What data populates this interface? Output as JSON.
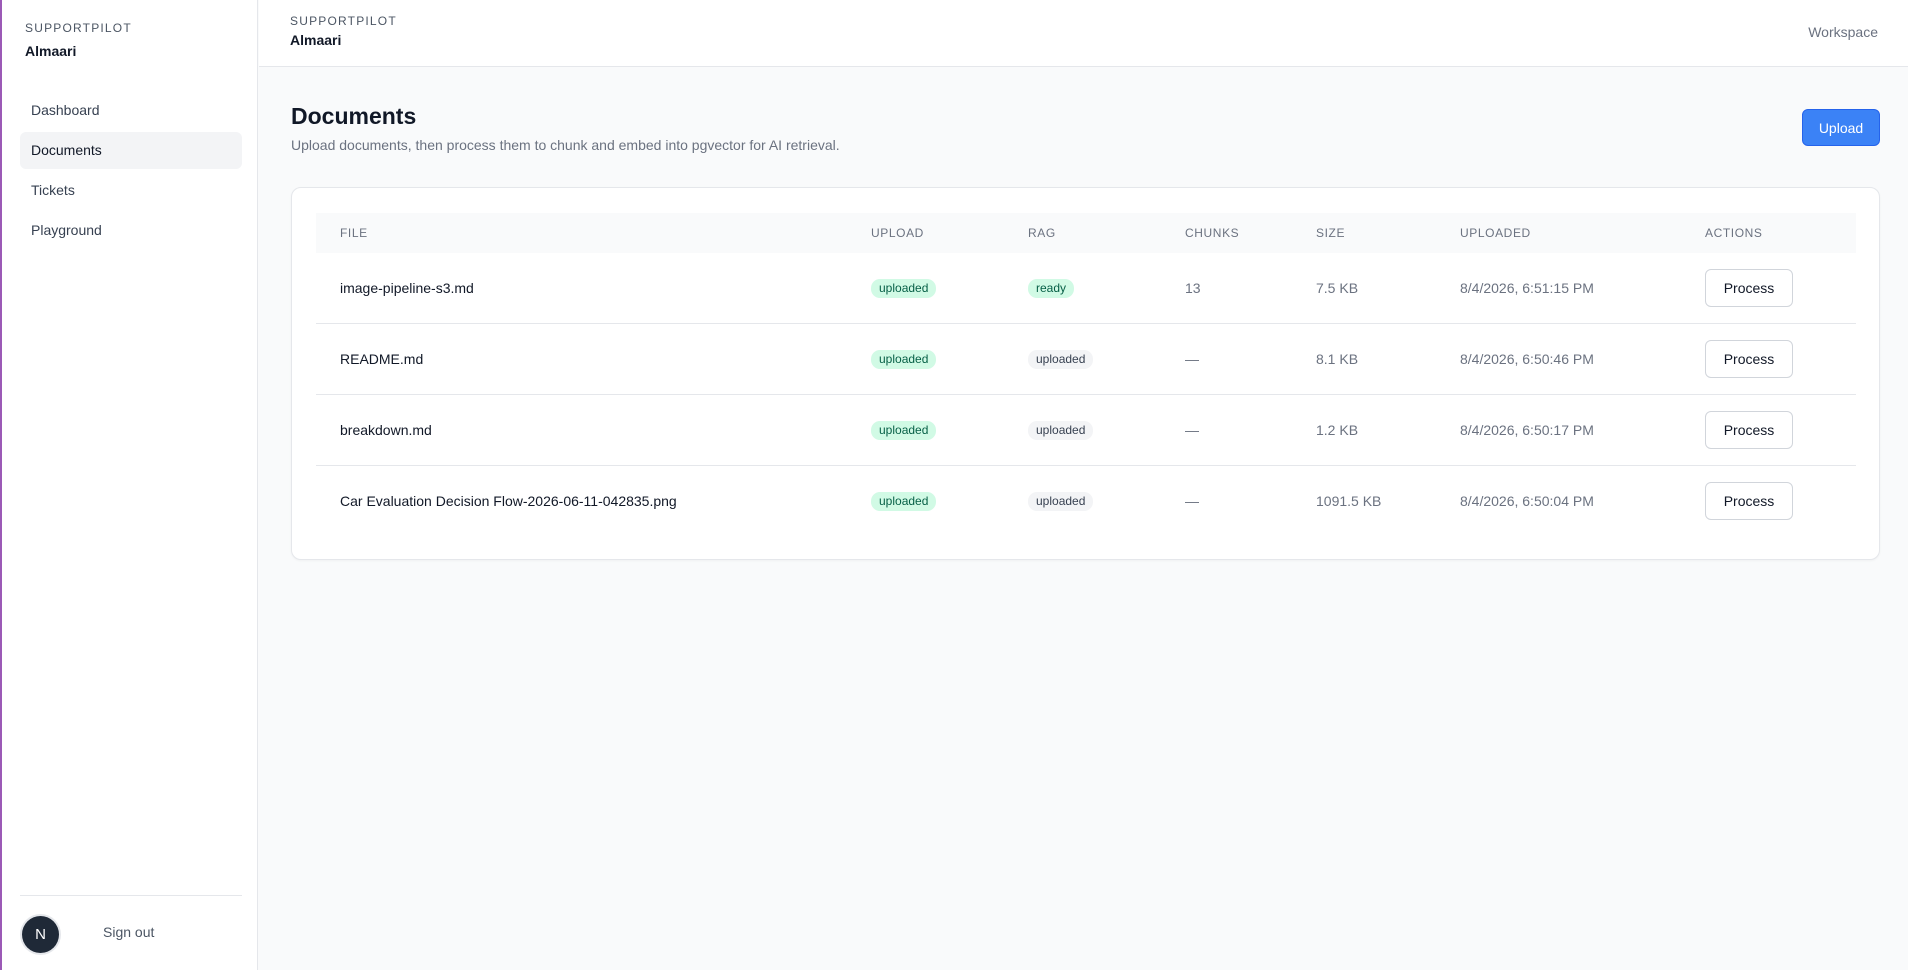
{
  "sidebar": {
    "kicker": "SUPPORTPILOT",
    "org": "Almaari",
    "nav": [
      "Dashboard",
      "Documents",
      "Tickets",
      "Playground"
    ],
    "active": "Documents",
    "avatar_letter": "N",
    "signout": "Sign out"
  },
  "topbar": {
    "kicker": "SUPPORTPILOT",
    "org": "Almaari",
    "workspace": "Workspace"
  },
  "page": {
    "title": "Documents",
    "subtitle": "Upload documents, then process them to chunk and embed into pgvector for AI retrieval.",
    "upload_label": "Upload"
  },
  "table": {
    "headers": [
      "FILE",
      "UPLOAD",
      "RAG",
      "CHUNKS",
      "SIZE",
      "UPLOADED",
      "ACTIONS"
    ],
    "rows": [
      {
        "file": "image-pipeline-s3.md",
        "upload": "uploaded",
        "rag": "ready",
        "chunks": "13",
        "size": "7.5 KB",
        "uploaded": "8/4/2026, 6:51:15 PM",
        "action": "Process"
      },
      {
        "file": "README.md",
        "upload": "uploaded",
        "rag": "uploaded",
        "chunks": "—",
        "size": "8.1 KB",
        "uploaded": "8/4/2026, 6:50:46 PM",
        "action": "Process"
      },
      {
        "file": "breakdown.md",
        "upload": "uploaded",
        "rag": "uploaded",
        "chunks": "—",
        "size": "1.2 KB",
        "uploaded": "8/4/2026, 6:50:17 PM",
        "action": "Process"
      },
      {
        "file": "Car Evaluation Decision Flow-2026-06-11-042835.png",
        "upload": "uploaded",
        "rag": "uploaded",
        "chunks": "—",
        "size": "1091.5 KB",
        "uploaded": "8/4/2026, 6:50:04 PM",
        "action": "Process"
      }
    ]
  },
  "colors": {
    "accent": "#3b82f6",
    "badge_ready": "#d1fae5",
    "badge_neutral": "#f3f4f6"
  }
}
